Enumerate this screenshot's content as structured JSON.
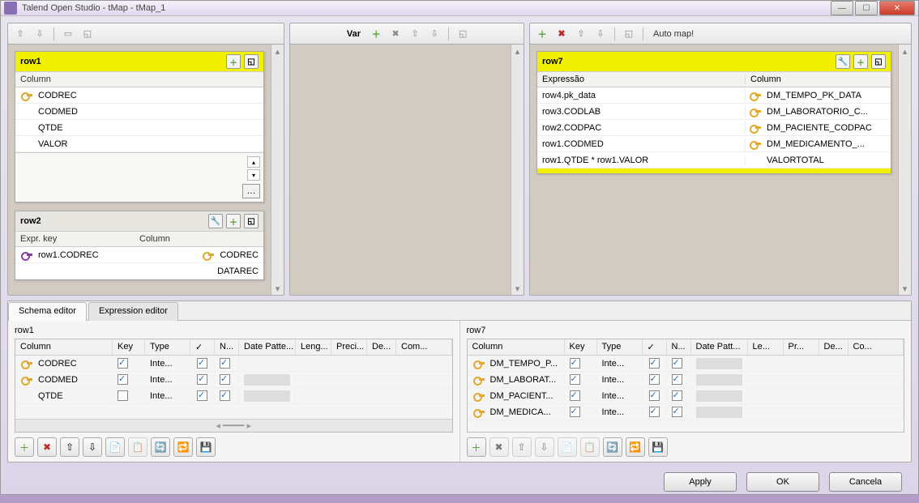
{
  "window": {
    "title": "Talend Open Studio - tMap - tMap_1"
  },
  "var_label": "Var",
  "automap_label": "Auto map!",
  "inputs": {
    "row1": {
      "title": "row1",
      "column_header": "Column",
      "rows": [
        {
          "key": true,
          "name": "CODREC"
        },
        {
          "key": false,
          "name": "CODMED"
        },
        {
          "key": false,
          "name": "QTDE"
        },
        {
          "key": false,
          "name": "VALOR"
        }
      ]
    },
    "row2": {
      "title": "row2",
      "expr_header": "Expr. key",
      "column_header": "Column",
      "rows": [
        {
          "expr": "row1.CODREC",
          "key": true,
          "name": "CODREC"
        },
        {
          "expr": "",
          "key": false,
          "name": "DATAREC"
        }
      ]
    }
  },
  "output": {
    "row7": {
      "title": "row7",
      "expr_header": "Expressão",
      "column_header": "Column",
      "rows": [
        {
          "expr": "row4.pk_data",
          "key": true,
          "name": "DM_TEMPO_PK_DATA"
        },
        {
          "expr": "row3.CODLAB",
          "key": true,
          "name": "DM_LABORATORIO_C..."
        },
        {
          "expr": "row2.CODPAC",
          "key": true,
          "name": "DM_PACIENTE_CODPAC"
        },
        {
          "expr": "row1.CODMED",
          "key": true,
          "name": "DM_MEDICAMENTO_..."
        },
        {
          "expr": "row1.QTDE * row1.VALOR",
          "key": false,
          "name": "VALORTOTAL"
        }
      ]
    }
  },
  "tabs": {
    "schema": "Schema editor",
    "expression": "Expression editor"
  },
  "schema_left": {
    "title": "row1",
    "headers": {
      "column": "Column",
      "key": "Key",
      "type": "Type",
      "chk": "✓",
      "n": "N...",
      "date": "Date Patte...",
      "len": "Leng...",
      "prec": "Preci...",
      "def": "De...",
      "com": "Com..."
    },
    "rows": [
      {
        "key": true,
        "name": "CODREC",
        "keychk": true,
        "type": "Inte...",
        "nn": true,
        "gray": false
      },
      {
        "key": true,
        "name": "CODMED",
        "keychk": true,
        "type": "Inte...",
        "nn": true,
        "gray": true
      },
      {
        "key": false,
        "name": "QTDE",
        "keychk": false,
        "type": "Inte...",
        "nn": true,
        "gray": true
      }
    ]
  },
  "schema_right": {
    "title": "row7",
    "headers": {
      "column": "Column",
      "key": "Key",
      "type": "Type",
      "chk": "✓",
      "n": "N...",
      "date": "Date Patt...",
      "len": "Le...",
      "prec": "Pr...",
      "def": "De...",
      "com": "Co..."
    },
    "rows": [
      {
        "key": true,
        "name": "DM_TEMPO_P...",
        "keychk": true,
        "type": "Inte...",
        "nn": true,
        "gray": true
      },
      {
        "key": true,
        "name": "DM_LABORAT...",
        "keychk": true,
        "type": "Inte...",
        "nn": true,
        "gray": true
      },
      {
        "key": true,
        "name": "DM_PACIENT...",
        "keychk": true,
        "type": "Inte...",
        "nn": true,
        "gray": true
      },
      {
        "key": true,
        "name": "DM_MEDICA...",
        "keychk": true,
        "type": "Inte...",
        "nn": true,
        "gray": true
      }
    ]
  },
  "buttons": {
    "apply": "Apply",
    "ok": "OK",
    "cancel": "Cancela"
  }
}
